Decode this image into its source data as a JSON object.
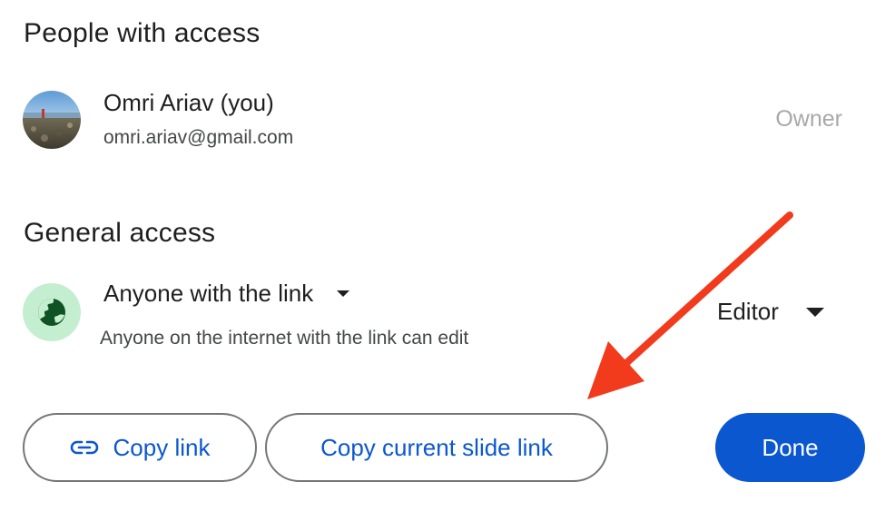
{
  "people_section": {
    "title": "People with access",
    "person": {
      "name": "Omri Ariav (you)",
      "email": "omri.ariav@gmail.com",
      "role": "Owner"
    }
  },
  "general_section": {
    "title": "General access",
    "access_option": "Anyone with the link",
    "access_description": "Anyone on the internet with the link can edit",
    "role": "Editor"
  },
  "actions": {
    "copy_link": "Copy link",
    "copy_slide_link": "Copy current slide link",
    "done": "Done"
  },
  "colors": {
    "primary_blue": "#0b57d0",
    "globe_bg": "#c4eed0",
    "arrow_red": "#f23a1d"
  },
  "icons": {
    "globe": "globe-icon",
    "link": "link-icon",
    "dropdown": "arrow-drop-down-icon"
  }
}
